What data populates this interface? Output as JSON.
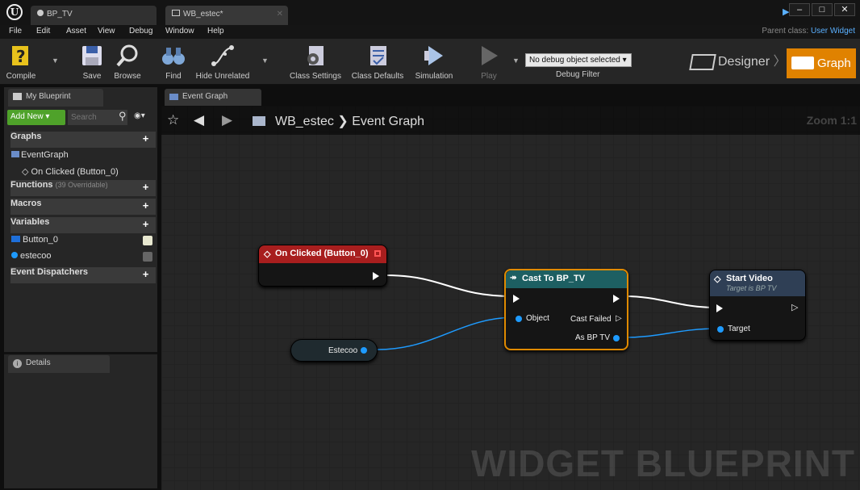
{
  "window": {
    "tabs": [
      {
        "label": "BP_TV"
      },
      {
        "label": "WB_estec*"
      }
    ],
    "controls": [
      "–",
      "□",
      "✕"
    ]
  },
  "menu": {
    "items": [
      "File",
      "Edit",
      "Asset",
      "View",
      "Debug",
      "Window",
      "Help"
    ],
    "parent_class_label": "Parent class:",
    "parent_class_value": "User Widget"
  },
  "toolbar": {
    "compile": "Compile",
    "save": "Save",
    "browse": "Browse",
    "find": "Find",
    "hide_unrelated": "Hide Unrelated",
    "class_settings": "Class Settings",
    "class_defaults": "Class Defaults",
    "simulation": "Simulation",
    "play": "Play",
    "debug_select": "No debug object selected",
    "debug_filter": "Debug Filter",
    "designer": "Designer",
    "graph": "Graph"
  },
  "left_panel": {
    "my_blueprint_tab": "My Blueprint",
    "add_new": "Add New",
    "search_placeholder": "Search",
    "graphs": "Graphs",
    "event_graph": "EventGraph",
    "on_clicked": "On Clicked (Button_0)",
    "functions": "Functions",
    "functions_sub": "(39 Overridable)",
    "macros": "Macros",
    "variables": "Variables",
    "var_button": "Button_0",
    "var_estecoo": "estecoo",
    "event_dispatchers": "Event Dispatchers",
    "details_tab": "Details"
  },
  "graph": {
    "tab": "Event Graph",
    "crumb_bp": "WB_estec",
    "crumb_sep": "❯",
    "crumb_graph": "Event Graph",
    "zoom": "Zoom 1:1",
    "watermark": "WIDGET BLUEPRINT",
    "node_onclicked": "On Clicked (Button_0)",
    "node_estecoo": "Estecoo",
    "node_cast": "Cast To BP_TV",
    "cast_object": "Object",
    "cast_failed": "Cast Failed",
    "cast_as": "As BP TV",
    "node_startvideo": "Start Video",
    "startvideo_sub": "Target is BP TV",
    "startvideo_target": "Target"
  },
  "colors": {
    "accent": "#e08200",
    "event_node": "#a81e1e",
    "cast_header": "#1d5f62",
    "function_header": "#2f3f55",
    "exec_wire": "#ffffff",
    "object_wire": "#1e9bff",
    "add_button": "#4fa22a",
    "parent_class": "#5ab0ff"
  }
}
